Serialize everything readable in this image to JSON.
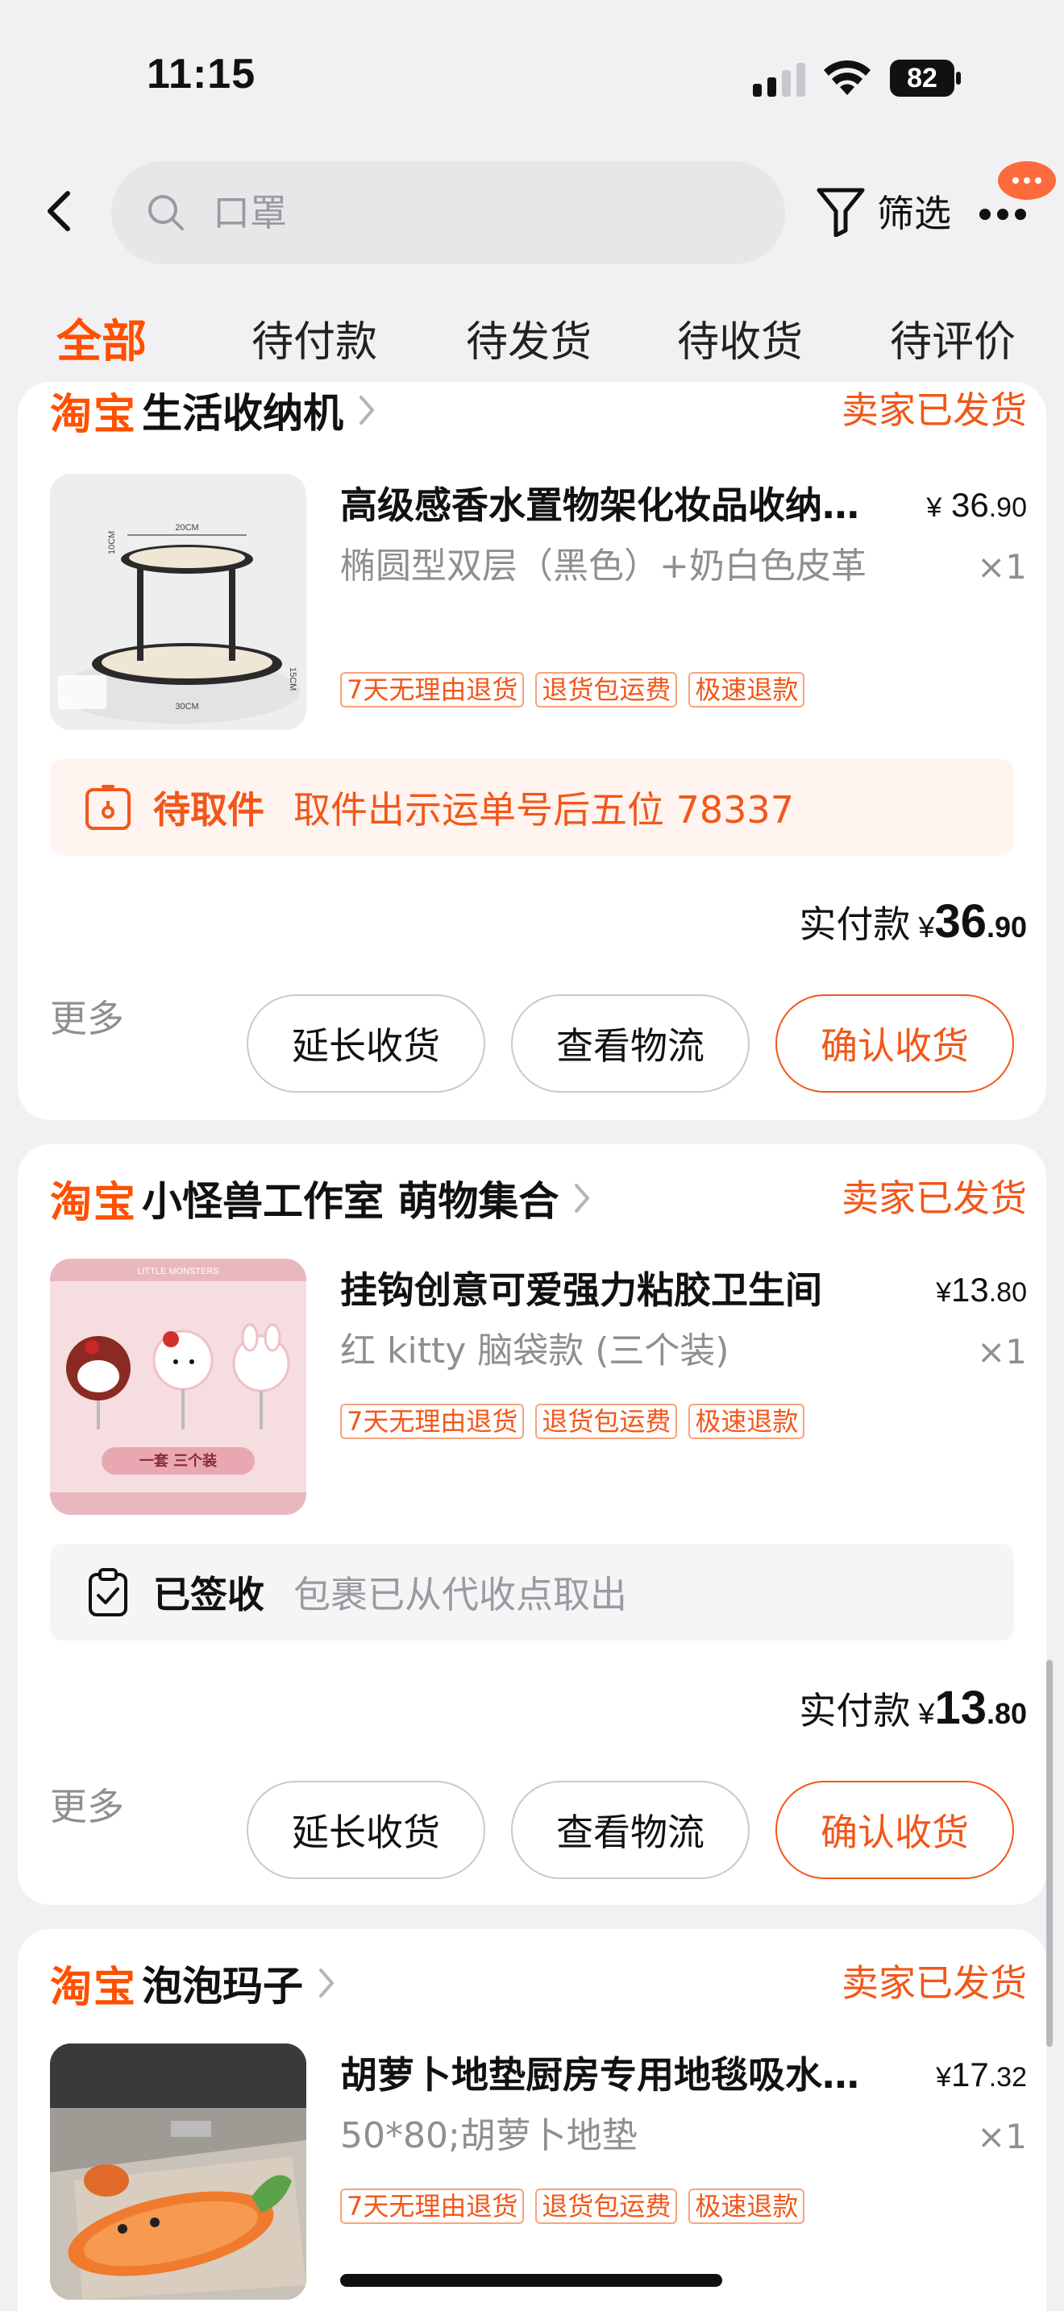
{
  "status_bar": {
    "time": "11:15",
    "battery": "82"
  },
  "search": {
    "query": "口罩",
    "filter_label": "筛选"
  },
  "tabs": [
    {
      "label": "全部",
      "active": true
    },
    {
      "label": "待付款",
      "active": false
    },
    {
      "label": "待发货",
      "active": false
    },
    {
      "label": "待收货",
      "active": false
    },
    {
      "label": "待评价",
      "active": false
    }
  ],
  "orders": [
    {
      "platform": "淘宝",
      "shop": "生活收纳机",
      "status": "卖家已发货",
      "title": "高级感香水置物架化妆品收纳托盘",
      "price_int": "36",
      "price_cents": ".90",
      "spec": "椭圆型双层（黑色）+奶白色皮革",
      "qty": "×1",
      "tags": [
        "7天无理由退货",
        "退货包运费",
        "极速退款"
      ],
      "notice_label": "待取件",
      "notice_text": "取件出示运单号后五位 78337",
      "paid_label": "实付款",
      "paid_int": "36",
      "paid_cents": ".90",
      "thumb_texts": [
        "20CM",
        "10CM",
        "30CM",
        "15CM"
      ]
    },
    {
      "platform": "淘宝",
      "shop": "小怪兽工作室 萌物集合",
      "status": "卖家已发货",
      "title": "挂钩创意可爱强力粘胶卫生间",
      "price_int": "13",
      "price_cents": ".80",
      "spec": "红 kitty 脑袋款 (三个装)",
      "qty": "×1",
      "tags": [
        "7天无理由退货",
        "退货包运费",
        "极速退款"
      ],
      "notice_label": "已签收",
      "notice_text": "包裹已从代收点取出",
      "paid_label": "实付款",
      "paid_int": "13",
      "paid_cents": ".80",
      "thumb_texts": [
        "LITTLE MONSTERS",
        "一套 三个装"
      ]
    },
    {
      "platform": "淘宝",
      "shop": "泡泡玛子",
      "status": "卖家已发货",
      "title": "胡萝卜地垫厨房专用地毯吸水防滑",
      "price_int": "17",
      "price_cents": ".32",
      "spec": "50*80;胡萝卜地垫",
      "qty": "×1",
      "tags": [
        "7天无理由退货",
        "退货包运费",
        "极速退款"
      ]
    }
  ],
  "actions": {
    "more": "更多",
    "extend": "延长收货",
    "logistics": "查看物流",
    "confirm": "确认收货"
  },
  "currency": "¥",
  "colors": {
    "accent": "#ff5000",
    "accent_text": "#f2571a",
    "badge": "#ff6a3d"
  }
}
